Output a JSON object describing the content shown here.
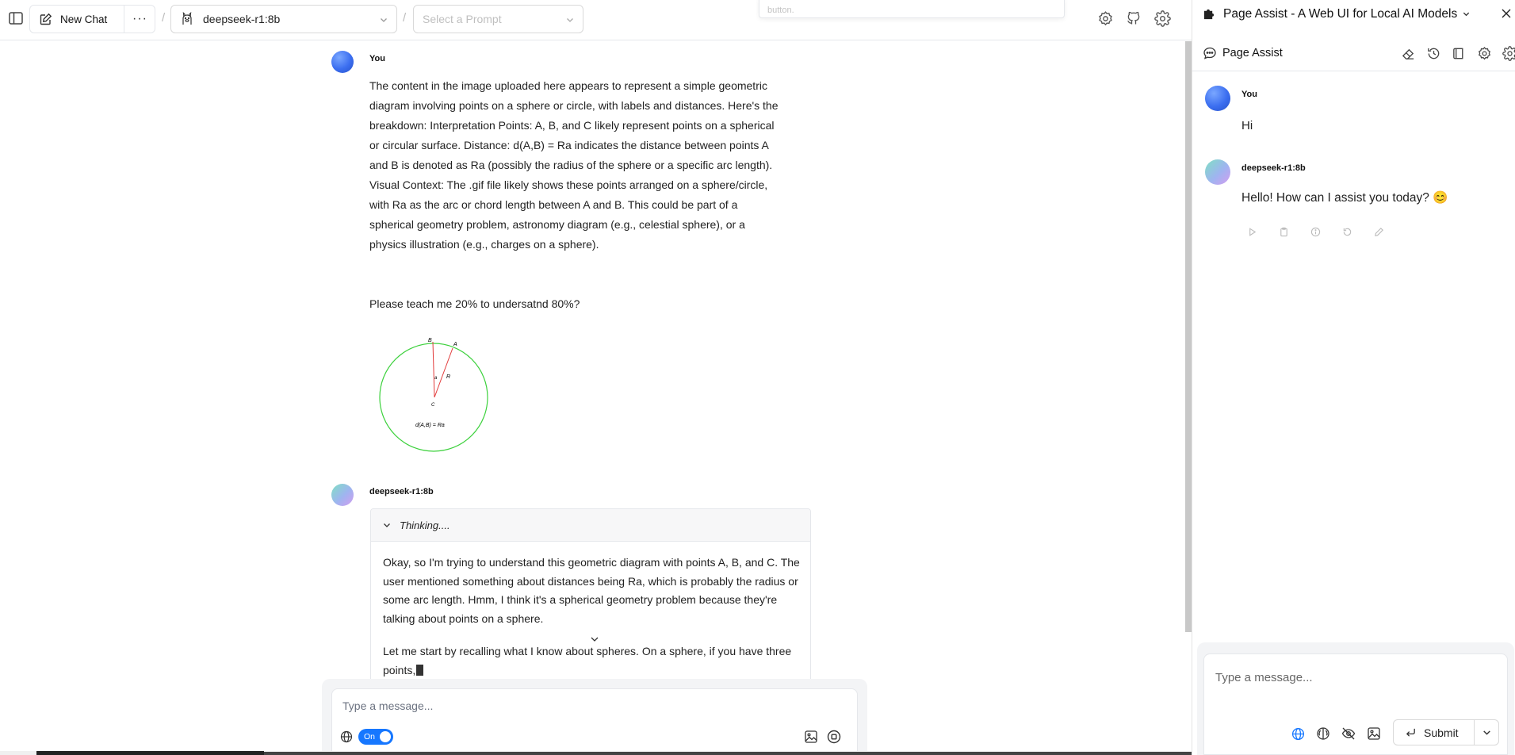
{
  "toolbar": {
    "new_chat_label": "New Chat",
    "more_label": "···",
    "separator": "/",
    "model": "deepseek-r1:8b",
    "prompt_placeholder": "Select a Prompt",
    "tooltip_text": "button."
  },
  "chat": {
    "messages": [
      {
        "sender": "You",
        "paragraphs": [
          "The content in the image uploaded here appears to represent a simple geometric diagram involving points on a sphere or circle, with labels and distances. Here's the breakdown: Interpretation Points: A, B, and C likely represent points on a spherical or circular surface. Distance: d(A,B) = Ra indicates the distance between points A and B is denoted as Ra (possibly the radius of the sphere or a specific arc length). Visual Context: The .gif file likely shows these points arranged on a sphere/circle, with Ra as the arc or chord length between A and B. This could be part of a spherical geometry problem, astronomy diagram (e.g., celestial sphere), or a physics illustration (e.g., charges on a sphere).",
          "Please teach me 20% to undersatnd 80%?"
        ],
        "diagram_labels": {
          "b": "B",
          "a": "A",
          "alpha": "a",
          "r": "R",
          "c": "C",
          "formula": "d(A,B) = Ra"
        }
      },
      {
        "sender": "deepseek-r1:8b",
        "thinking_label": "Thinking....",
        "thinking_paragraphs": [
          "Okay, so I'm trying to understand this geometric diagram with points A, B, and C. The user mentioned something about distances being Ra, which is probably the radius or some arc length. Hmm, I think it's a spherical geometry problem because they're talking about points on a sphere.",
          "Let me start by recalling what I know about spheres. On a sphere, if you have three points,"
        ]
      }
    ]
  },
  "composer": {
    "placeholder": "Type a message...",
    "toggle_label": "On",
    "toggle_color": "#1677ff"
  },
  "sidepanel": {
    "window_title": "Page Assist - A Web UI for Local AI Models",
    "brand": "Page Assist",
    "messages": [
      {
        "sender": "You",
        "text": "Hi"
      },
      {
        "sender": "deepseek-r1:8b",
        "text": "Hello! How can I assist you today? 😊"
      }
    ],
    "input_placeholder": "Type a message...",
    "submit_label": "Submit"
  },
  "colors": {
    "accent": "#1677ff",
    "web_icon_color": "#1677ff",
    "diagram_circle": "#3dd13d",
    "diagram_lines": "#e23b3b"
  }
}
